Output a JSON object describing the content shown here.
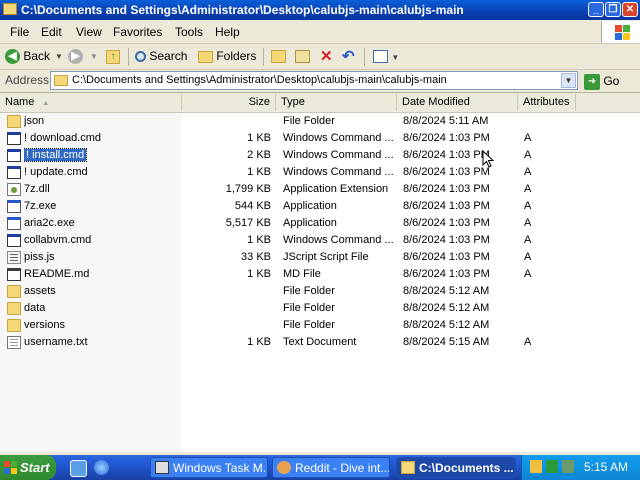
{
  "window": {
    "title": "C:\\Documents and Settings\\Administrator\\Desktop\\calubjs-main\\calubjs-main",
    "buttons": {
      "minimize": "_",
      "maximize": "❐",
      "close": "✕"
    }
  },
  "menu": [
    "File",
    "Edit",
    "View",
    "Favorites",
    "Tools",
    "Help"
  ],
  "toolbar": {
    "back": "Back",
    "search": "Search",
    "folders": "Folders"
  },
  "address": {
    "label": "Address",
    "value": "C:\\Documents and Settings\\Administrator\\Desktop\\calubjs-main\\calubjs-main",
    "go": "Go"
  },
  "columns": {
    "name": "Name",
    "size": "Size",
    "type": "Type",
    "date": "Date Modified",
    "attributes": "Attributes"
  },
  "files": [
    {
      "name": "json",
      "size": "",
      "type": "File Folder",
      "date": "8/8/2024 5:11 AM",
      "attr": "",
      "icon": "folder"
    },
    {
      "name": "! download.cmd",
      "size": "1 KB",
      "type": "Windows Command ...",
      "date": "8/6/2024 1:03 PM",
      "attr": "A",
      "icon": "cmd"
    },
    {
      "name": "! install.cmd",
      "size": "2 KB",
      "type": "Windows Command ...",
      "date": "8/6/2024 1:03 PM",
      "attr": "A",
      "icon": "cmd",
      "selected": true
    },
    {
      "name": "! update.cmd",
      "size": "1 KB",
      "type": "Windows Command ...",
      "date": "8/6/2024 1:03 PM",
      "attr": "A",
      "icon": "cmd"
    },
    {
      "name": "7z.dll",
      "size": "1,799 KB",
      "type": "Application Extension",
      "date": "8/6/2024 1:03 PM",
      "attr": "A",
      "icon": "dll"
    },
    {
      "name": "7z.exe",
      "size": "544 KB",
      "type": "Application",
      "date": "8/6/2024 1:03 PM",
      "attr": "A",
      "icon": "exe"
    },
    {
      "name": "aria2c.exe",
      "size": "5,517 KB",
      "type": "Application",
      "date": "8/6/2024 1:03 PM",
      "attr": "A",
      "icon": "exe"
    },
    {
      "name": "collabvm.cmd",
      "size": "1 KB",
      "type": "Windows Command ...",
      "date": "8/6/2024 1:03 PM",
      "attr": "A",
      "icon": "cmd"
    },
    {
      "name": "piss.js",
      "size": "33 KB",
      "type": "JScript Script File",
      "date": "8/6/2024 1:03 PM",
      "attr": "A",
      "icon": "js"
    },
    {
      "name": "README.md",
      "size": "1 KB",
      "type": "MD File",
      "date": "8/6/2024 1:03 PM",
      "attr": "A",
      "icon": "md"
    },
    {
      "name": "assets",
      "size": "",
      "type": "File Folder",
      "date": "8/8/2024 5:12 AM",
      "attr": "",
      "icon": "folder"
    },
    {
      "name": "data",
      "size": "",
      "type": "File Folder",
      "date": "8/8/2024 5:12 AM",
      "attr": "",
      "icon": "folder"
    },
    {
      "name": "versions",
      "size": "",
      "type": "File Folder",
      "date": "8/8/2024 5:12 AM",
      "attr": "",
      "icon": "folder"
    },
    {
      "name": "username.txt",
      "size": "1 KB",
      "type": "Text Document",
      "date": "8/8/2024 5:15 AM",
      "attr": "A",
      "icon": "txt"
    }
  ],
  "taskbar": {
    "start": "Start",
    "tasks": [
      {
        "label": "Windows Task M...",
        "active": false
      },
      {
        "label": "Reddit - Dive int...",
        "active": false
      },
      {
        "label": "C:\\Documents ...",
        "active": true
      }
    ],
    "clock": "5:15 AM"
  },
  "colors": {
    "titlebar": "#0a5fd8",
    "selection": "#316ac5",
    "taskbar": "#245edb",
    "start": "#2f8a2f"
  }
}
